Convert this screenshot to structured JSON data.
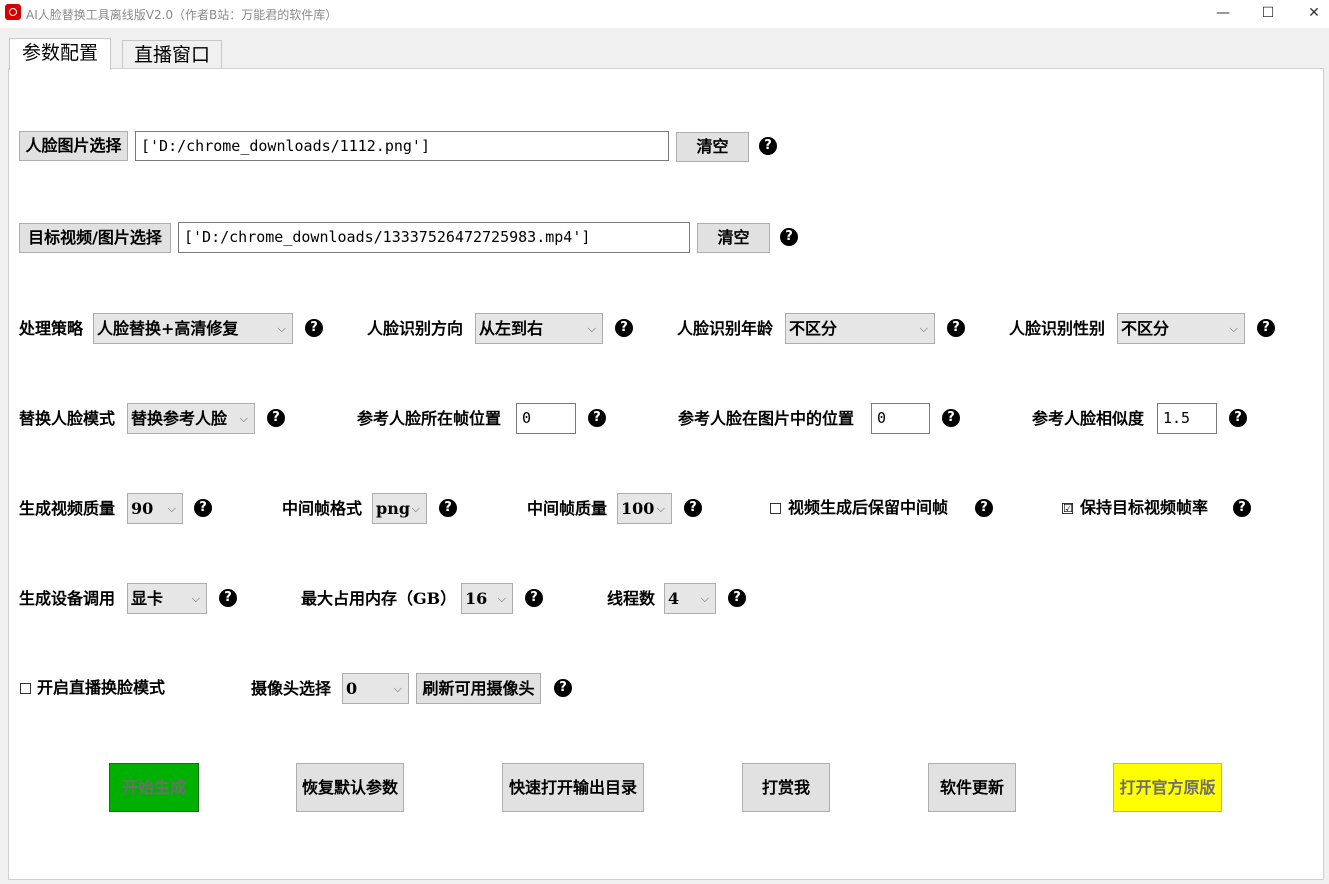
{
  "window": {
    "title": "AI人脸替换工具离线版V2.0（作者B站：万能君的软件库）",
    "minimize": "—",
    "maximize": "☐",
    "close": "✕"
  },
  "tabs": [
    "参数配置",
    "直播窗口"
  ],
  "face_image": {
    "button": "人脸图片选择",
    "value": "['D:/chrome_downloads/1112.png']",
    "clear": "清空"
  },
  "target": {
    "button": "目标视频/图片选择",
    "value": "['D:/chrome_downloads/13337526472725983.mp4']",
    "clear": "清空"
  },
  "row1": {
    "strategy_label": "处理策略",
    "strategy_value": "人脸替换+高清修复",
    "direction_label": "人脸识别方向",
    "direction_value": "从左到右",
    "age_label": "人脸识别年龄",
    "age_value": "不区分",
    "gender_label": "人脸识别性别",
    "gender_value": "不区分"
  },
  "row2": {
    "mode_label": "替换人脸模式",
    "mode_value": "替换参考人脸",
    "frame_pos_label": "参考人脸所在帧位置",
    "frame_pos_value": "0",
    "img_pos_label": "参考人脸在图片中的位置",
    "img_pos_value": "0",
    "similarity_label": "参考人脸相似度",
    "similarity_value": "1.5"
  },
  "row3": {
    "quality_label": "生成视频质量",
    "quality_value": "90",
    "frame_format_label": "中间帧格式",
    "frame_format_value": "png",
    "frame_quality_label": "中间帧质量",
    "frame_quality_value": "100",
    "keep_frames_label": "视频生成后保留中间帧",
    "keep_frames_checked": false,
    "keep_fps_label": "保持目标视频帧率",
    "keep_fps_checked": true
  },
  "row4": {
    "device_label": "生成设备调用",
    "device_value": "显卡",
    "memory_label": "最大占用内存（GB）",
    "memory_value": "16",
    "threads_label": "线程数",
    "threads_value": "4"
  },
  "row5": {
    "live_label": "开启直播换脸模式",
    "live_checked": false,
    "camera_label": "摄像头选择",
    "camera_value": "0",
    "refresh_button": "刷新可用摄像头"
  },
  "help_glyph": "?",
  "check_on": "☑",
  "actions": {
    "start": "开始生成",
    "reset": "恢复默认参数",
    "open_output": "快速打开输出目录",
    "donate": "打赏我",
    "update": "软件更新",
    "official": "打开官方原版"
  },
  "colors": {
    "start_bg": "#00b000",
    "start_fg": "#6e6e6e",
    "official_bg": "#ffff00",
    "official_fg": "#6e6e6e"
  }
}
